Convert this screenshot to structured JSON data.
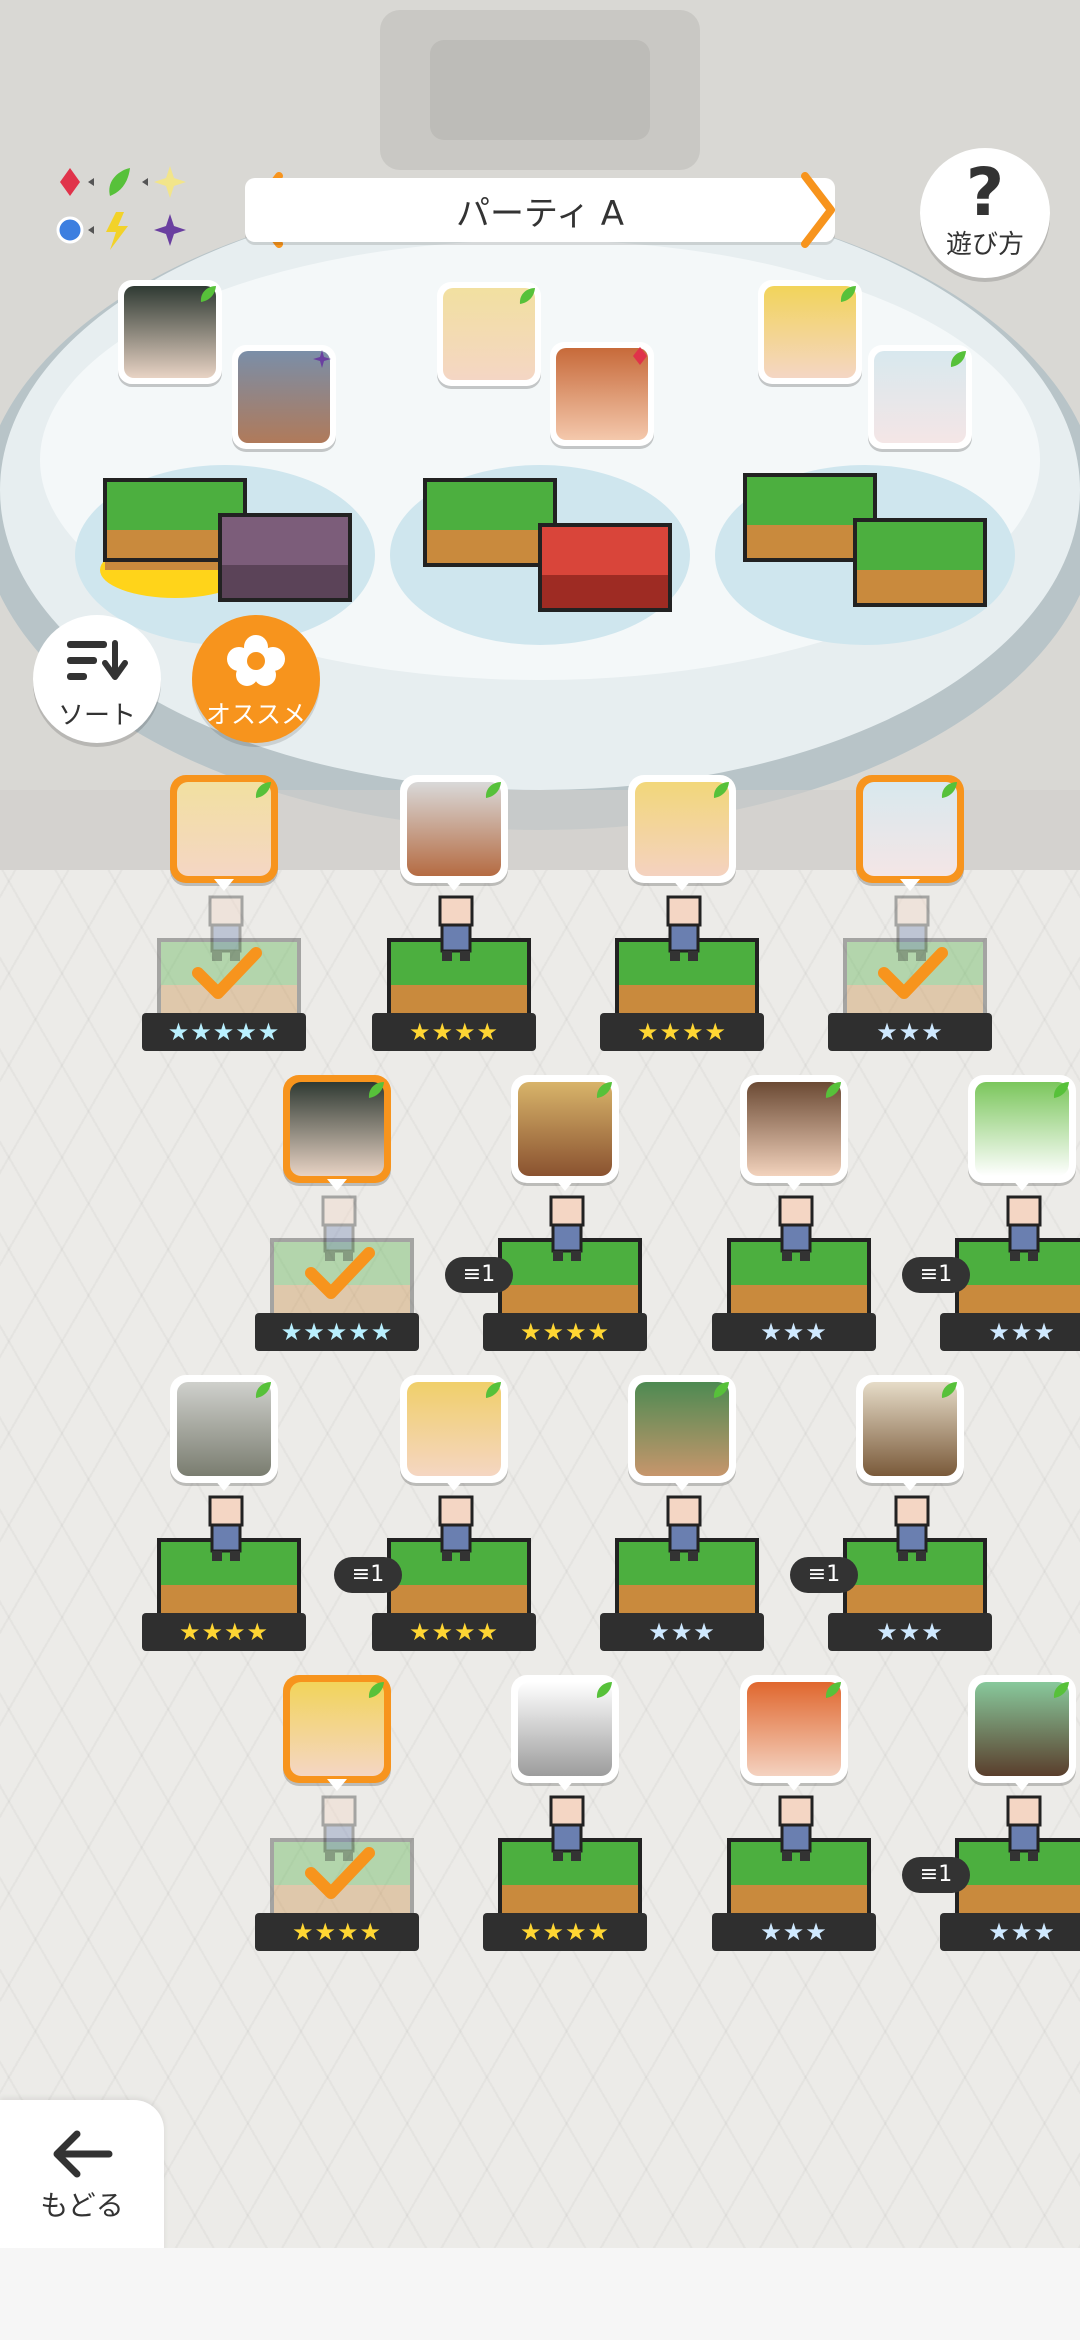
{
  "header": {
    "party_name": "パーティ A",
    "help_label": "遊び方"
  },
  "controls": {
    "sort_label": "ソート",
    "recommend_label": "オススメ",
    "back_label": "もどる"
  },
  "colors": {
    "accent": "#f7941d",
    "grass": "#4caf3f",
    "dirt": "#c98a3d",
    "star_gold": "#ffd633",
    "star_blue": "#cfe9ff",
    "element_green": "#57c13a",
    "element_red": "#e0334a",
    "element_purple": "#6a3fa0",
    "element_blue": "#3d7fe0",
    "element_yellow": "#f2d229"
  },
  "party_slots": [
    {
      "element": "leaf-icon",
      "selected": true
    },
    {
      "element": "dark-star-icon"
    },
    {
      "element": "leaf-icon"
    },
    {
      "element": "fire-diamond-icon"
    },
    {
      "element": "leaf-icon"
    },
    {
      "element": "leaf-icon"
    }
  ],
  "roster": [
    {
      "element": "leaf-icon",
      "stars": "★★★★★",
      "rarity": 5,
      "in_party": true
    },
    {
      "element": "leaf-icon",
      "stars": "★★★★",
      "rarity": 4
    },
    {
      "element": "leaf-icon",
      "stars": "★★★★",
      "rarity": 4
    },
    {
      "element": "leaf-icon",
      "stars": "★★★",
      "rarity": 3,
      "in_party": true
    },
    {
      "element": "leaf-icon",
      "stars": "★★★★★",
      "rarity": 5,
      "in_party": true
    },
    {
      "element": "leaf-icon",
      "stars": "★★★★",
      "rarity": 4,
      "dupes": "1"
    },
    {
      "element": "leaf-icon",
      "stars": "★★★",
      "rarity": 3
    },
    {
      "element": "leaf-icon",
      "stars": "★★★",
      "rarity": 3,
      "dupes": "1"
    },
    {
      "element": "leaf-icon",
      "stars": "★★★★",
      "rarity": 4
    },
    {
      "element": "leaf-icon",
      "stars": "★★★★",
      "rarity": 4,
      "dupes": "1"
    },
    {
      "element": "leaf-icon",
      "stars": "★★★",
      "rarity": 3
    },
    {
      "element": "leaf-icon",
      "stars": "★★★",
      "rarity": 3,
      "dupes": "1"
    },
    {
      "element": "leaf-icon",
      "stars": "★★★★",
      "rarity": 4,
      "in_party": true
    },
    {
      "element": "leaf-icon",
      "stars": "★★★★",
      "rarity": 4
    },
    {
      "element": "leaf-icon",
      "stars": "★★★",
      "rarity": 3
    },
    {
      "element": "leaf-icon",
      "stars": "★★★",
      "rarity": 3,
      "dupes": "1"
    }
  ]
}
